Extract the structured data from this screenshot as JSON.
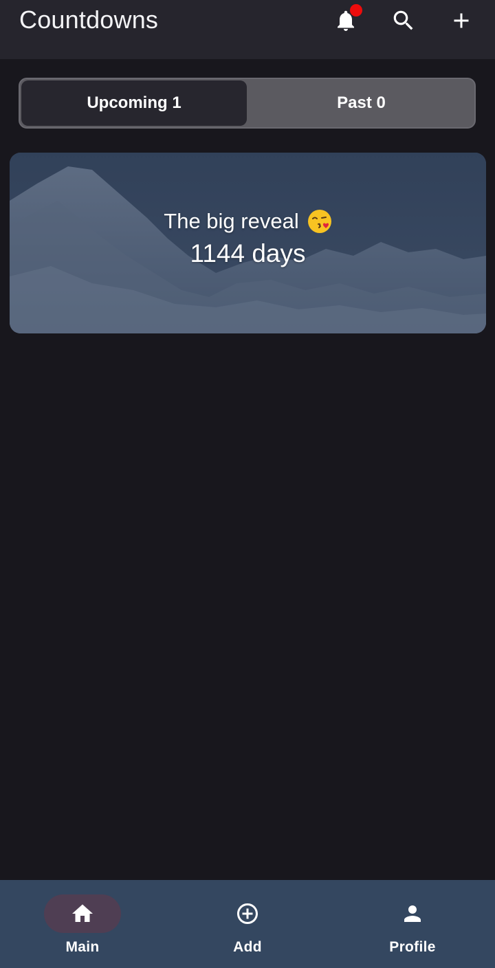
{
  "app": {
    "title": "Countdowns",
    "actions": [
      {
        "icon": "bell-icon",
        "has_notification": true
      },
      {
        "icon": "search-icon"
      },
      {
        "icon": "plus-icon"
      }
    ]
  },
  "tabs": [
    {
      "label": "Upcoming 1",
      "selected": true
    },
    {
      "label": "Past 0",
      "selected": false
    }
  ],
  "countdowns": [
    {
      "title": "The big reveal",
      "emoji": "kissing-face-emoji",
      "days": "1144 days"
    }
  ],
  "bottom_nav": [
    {
      "label": "Main",
      "icon": "home-icon",
      "selected": true
    },
    {
      "label": "Add",
      "icon": "add-circle-icon",
      "selected": false
    },
    {
      "label": "Profile",
      "icon": "person-icon",
      "selected": false
    }
  ],
  "colors": {
    "background": "#18171d",
    "appbar": "#26252d",
    "notification_dot": "#ee0c0c",
    "bottom_nav": "#344760",
    "nav_selected_pill": "#4f3e53"
  }
}
